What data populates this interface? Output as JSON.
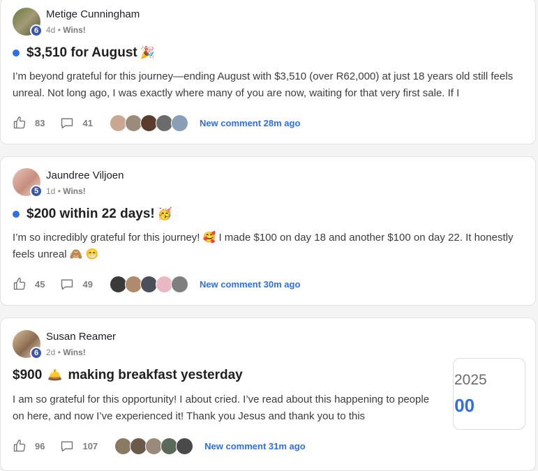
{
  "posts": [
    {
      "author": "Metige Cunningham",
      "level": "6",
      "age": "4d",
      "category": "Wins!",
      "title": "$3,510 for August",
      "title_emoji": "🎉",
      "body": "I’m beyond grateful for this journey—ending August with $3,510 (over R62,000) at just 18 years old still feels unreal. Not long ago, I was exactly where many of you are now, waiting for that very first sale. If I",
      "likes": "83",
      "comments": "41",
      "new_comment": "New comment 28m ago"
    },
    {
      "author": "Jaundree Viljoen",
      "level": "5",
      "age": "1d",
      "category": "Wins!",
      "title": "$200 within 22 days!",
      "title_emoji": "🥳",
      "body": "I’m so incredibly grateful for this journey! 🥰 I made $100 on day 18 and another $100 on day 22. It honestly feels unreal 🙈 😁",
      "likes": "45",
      "comments": "49",
      "new_comment": "New comment 30m ago"
    },
    {
      "author": "Susan Reamer",
      "level": "6",
      "age": "2d",
      "category": "Wins!",
      "title_part1": "$900",
      "title_emoji": "🛎️",
      "title_part2": "making breakfast yesterday",
      "body": "I am so grateful for this opportunity! I about cried. I’ve read about this happening to people on here, and now I’ve experienced it! Thank you Jesus and thank you to this",
      "likes": "96",
      "comments": "107",
      "new_comment": "New comment 31m ago"
    }
  ],
  "popup": {
    "year": "2025",
    "amount": ".00"
  },
  "colors": {
    "accent": "#2f6fe4",
    "level_badge": "#3b57a9",
    "unread_dot": "#2f6fe4"
  },
  "icons": {
    "like": "thumbs-up-icon",
    "comment": "speech-bubble-icon"
  }
}
